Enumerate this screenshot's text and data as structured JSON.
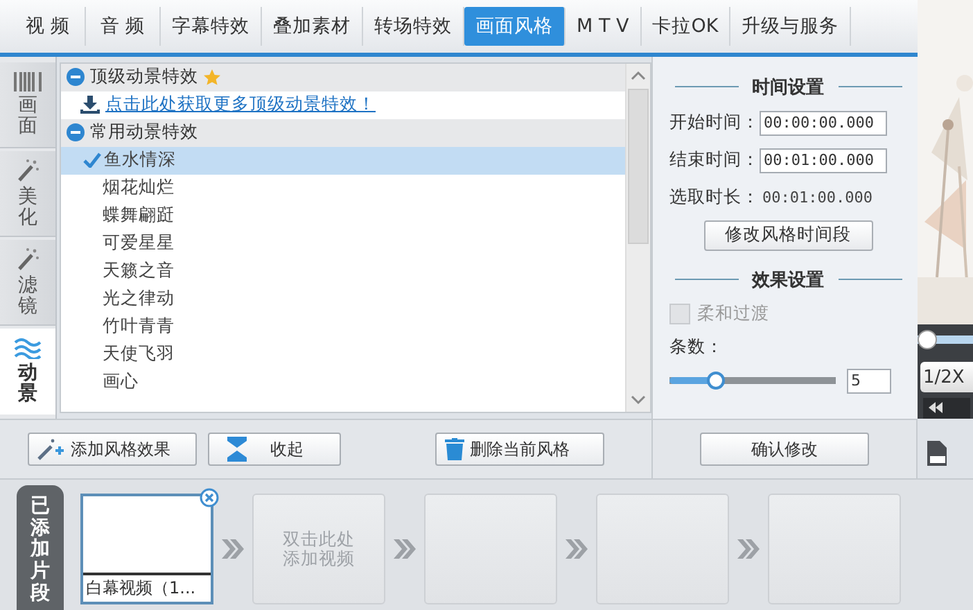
{
  "tabs": [
    {
      "label": "视 频",
      "selected": false
    },
    {
      "label": "音 频",
      "selected": false
    },
    {
      "label": "字幕特效",
      "selected": false
    },
    {
      "label": "叠加素材",
      "selected": false
    },
    {
      "label": "转场特效",
      "selected": false
    },
    {
      "label": "画面风格",
      "selected": true
    },
    {
      "label": "M T V",
      "selected": false
    },
    {
      "label": "卡拉OK",
      "selected": false
    },
    {
      "label": "升级与服务",
      "selected": false
    }
  ],
  "side_tabs": [
    {
      "label": "画面",
      "kind": "film",
      "selected": false
    },
    {
      "label": "美化",
      "kind": "wand",
      "selected": false
    },
    {
      "label": "滤镜",
      "kind": "wand",
      "selected": false
    },
    {
      "label": "动景",
      "kind": "wave",
      "selected": true
    }
  ],
  "effect_groups": [
    {
      "title": "顶级动景特效",
      "premium": true,
      "expanded": true,
      "link": "点击此处获取更多顶级动景特效！"
    },
    {
      "title": "常用动景特效",
      "premium": false,
      "expanded": true,
      "items": [
        {
          "label": "鱼水情深",
          "selected": true
        },
        {
          "label": "烟花灿烂",
          "selected": false
        },
        {
          "label": "蝶舞翩跹",
          "selected": false
        },
        {
          "label": "可爱星星",
          "selected": false
        },
        {
          "label": "天籁之音",
          "selected": false
        },
        {
          "label": "光之律动",
          "selected": false
        },
        {
          "label": "竹叶青青",
          "selected": false
        },
        {
          "label": "天使飞羽",
          "selected": false
        },
        {
          "label": "画心",
          "selected": false
        }
      ]
    }
  ],
  "time_settings": {
    "title": "时间设置",
    "start_label": "开始时间：",
    "start": "00:00:00.000",
    "end_label": "结束时间：",
    "end": "00:01:00.000",
    "duration_label": "选取时长：",
    "duration": "00:01:00.000",
    "button": "修改风格时间段"
  },
  "effect_settings": {
    "title": "效果设置",
    "smooth": {
      "label": "柔和过渡",
      "checked": false,
      "disabled": true
    },
    "count_label": "条数：",
    "count": {
      "level": 0.25,
      "value": "5"
    }
  },
  "toolbar": {
    "add": "添加风格效果",
    "collapse": "收起",
    "delete": "删除当前风格",
    "confirm": "确认修改"
  },
  "preview": {
    "seek": {
      "level": 0
    },
    "speed": "1/2X"
  },
  "clips": {
    "label": "已添加片段",
    "items": [
      {
        "kind": "clip",
        "name": "白幕视频（1...",
        "selected": true
      },
      {
        "kind": "add",
        "hint": "双击此处添加视频"
      },
      {
        "kind": "blank"
      },
      {
        "kind": "blank"
      },
      {
        "kind": "blank"
      }
    ]
  }
}
